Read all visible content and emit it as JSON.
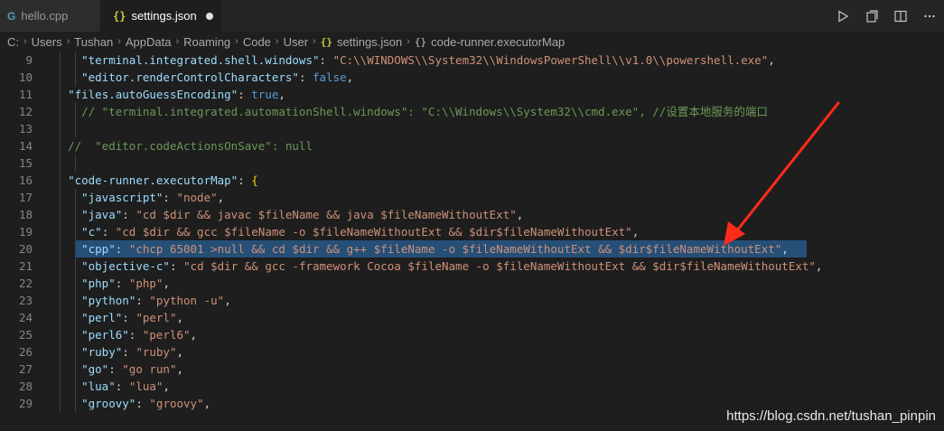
{
  "tabs": [
    {
      "label": "hello.cpp",
      "icon": "cpp-file-icon"
    },
    {
      "label": "settings.json",
      "icon": "json-file-icon",
      "dirty": true
    }
  ],
  "breadcrumb": [
    "C:",
    "Users",
    "Tushan",
    "AppData",
    "Roaming",
    "Code",
    "User",
    "settings.json",
    "code-runner.executorMap"
  ],
  "editor_lines": [
    {
      "n": "9",
      "text": "    \"terminal.integrated.shell.windows\": \"C:\\\\WINDOWS\\\\System32\\\\WindowsPowerShell\\\\v1.0\\\\powershell.exe\","
    },
    {
      "n": "10",
      "text": "    \"editor.renderControlCharacters\": false,"
    },
    {
      "n": "11",
      "text": "  \"files.autoGuessEncoding\": true,"
    },
    {
      "n": "12",
      "text": "    // \"terminal.integrated.automationShell.windows\": \"C:\\\\Windows\\\\System32\\\\cmd.exe\", //设置本地服务的端口"
    },
    {
      "n": "13",
      "text": ""
    },
    {
      "n": "14",
      "text": "  //  \"editor.codeActionsOnSave\": null"
    },
    {
      "n": "15",
      "text": ""
    },
    {
      "n": "16",
      "text": "  \"code-runner.executorMap\": {"
    },
    {
      "n": "17",
      "text": "    \"javascript\": \"node\","
    },
    {
      "n": "18",
      "text": "    \"java\": \"cd $dir && javac $fileName && java $fileNameWithoutExt\","
    },
    {
      "n": "19",
      "text": "    \"c\": \"cd $dir && gcc $fileName -o $fileNameWithoutExt && $dir$fileNameWithoutExt\","
    },
    {
      "n": "20",
      "text": "    \"cpp\": \"chcp 65001 >null && cd $dir && g++ $fileName -o $fileNameWithoutExt && $dir$fileNameWithoutExt\","
    },
    {
      "n": "21",
      "text": "    \"objective-c\": \"cd $dir && gcc -framework Cocoa $fileName -o $fileNameWithoutExt && $dir$fileNameWithoutExt\","
    },
    {
      "n": "22",
      "text": "    \"php\": \"php\","
    },
    {
      "n": "23",
      "text": "    \"python\": \"python -u\","
    },
    {
      "n": "24",
      "text": "    \"perl\": \"perl\","
    },
    {
      "n": "25",
      "text": "    \"perl6\": \"perl6\","
    },
    {
      "n": "26",
      "text": "    \"ruby\": \"ruby\","
    },
    {
      "n": "27",
      "text": "    \"go\": \"go run\","
    },
    {
      "n": "28",
      "text": "    \"lua\": \"lua\","
    },
    {
      "n": "29",
      "text": "    \"groovy\": \"groovy\","
    }
  ],
  "selected_line": "20",
  "watermark": "https://blog.csdn.net/tushan_pinpin",
  "colors": {
    "key": "#9cdcfe",
    "string": "#ce9178",
    "boolean": "#569cd6",
    "comment": "#6a9955",
    "selection": "#264f78",
    "arrow": "#ff2a1a"
  },
  "toolbar_icons": [
    "run-icon",
    "open-preview-icon",
    "split-editor-icon",
    "more-actions-icon"
  ]
}
